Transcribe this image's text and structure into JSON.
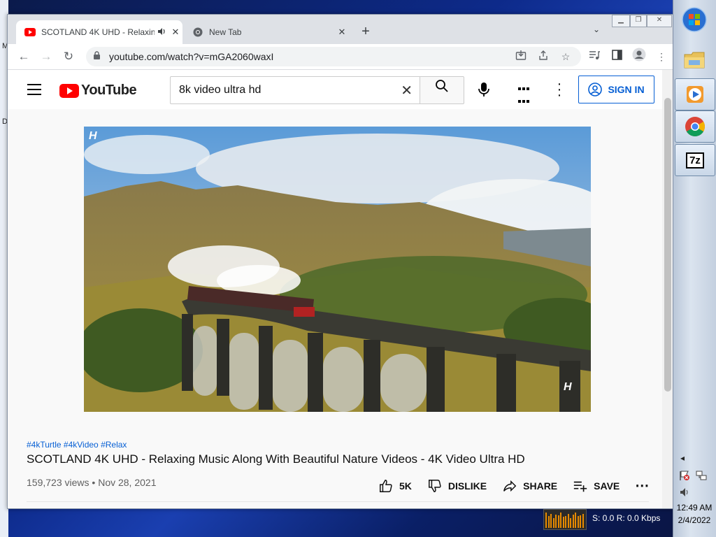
{
  "desktop": {
    "letters": [
      "M",
      "D"
    ]
  },
  "browser": {
    "tabs": [
      {
        "title": "SCOTLAND 4K UHD - Relaxin",
        "active": true,
        "audio": true
      },
      {
        "title": "New Tab",
        "active": false
      }
    ],
    "new_tab_glyph": "+",
    "tab_search_glyph": "⌄",
    "url": "youtube.com/watch?v=mGA2060waxI"
  },
  "youtube": {
    "logo_text": "YouTube",
    "search_query": "8k video ultra hd",
    "signin_label": "SIGN IN",
    "video": {
      "watermark": "H",
      "hashtags": "#4kTurtle #4kVideo #Relax",
      "title": "SCOTLAND 4K UHD - Relaxing Music Along With Beautiful Nature Videos - 4K Video Ultra HD",
      "views": "159,723 views",
      "date": "Nov 28, 2021",
      "likes": "5K",
      "dislike_label": "DISLIKE",
      "share_label": "SHARE",
      "save_label": "SAVE"
    }
  },
  "taskbar": {
    "apps": [
      "windows-start",
      "file-explorer",
      "media-player",
      "chrome",
      "7zip"
    ],
    "sevenzip_label": "7z",
    "time": "12:49 AM",
    "date": "2/4/2022"
  },
  "net_monitor": {
    "text": "S: 0.0  R: 0.0 Kbps",
    "bars": [
      0.9,
      0.7,
      0.85,
      0.6,
      0.8,
      0.75,
      0.9,
      0.65,
      0.7,
      0.85,
      0.6,
      0.8,
      0.9,
      0.7,
      0.75,
      0.85
    ]
  }
}
